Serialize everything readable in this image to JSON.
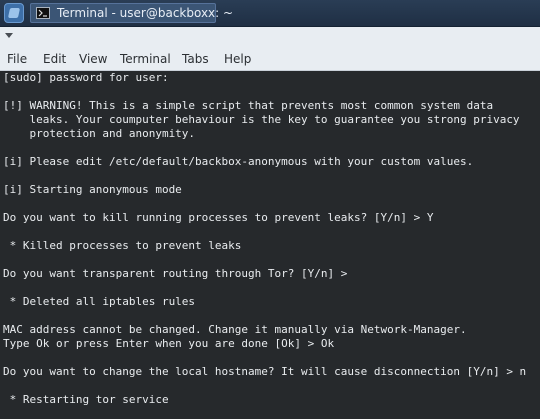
{
  "taskbar": {
    "launcher_icon": "backbox-logo-icon",
    "task": {
      "icon": "terminal-icon",
      "label": "Terminal - user@backboxx: ~"
    }
  },
  "toolbar": {
    "collapse_icon": "chevron-down-icon"
  },
  "menu": {
    "items": [
      "File",
      "Edit",
      "View",
      "Terminal",
      "Tabs",
      "Help"
    ]
  },
  "terminal": {
    "lines": [
      "[sudo] password for user:",
      "[!] WARNING! This is a simple script that prevents most common system data",
      "    leaks. Your coumputer behaviour is the key to guarantee you strong privacy",
      "    protection and anonymity.",
      "[i] Please edit /etc/default/backbox-anonymous with your custom values.",
      "[i] Starting anonymous mode",
      "Do you want to kill running processes to prevent leaks? [Y/n] > Y",
      " * Killed processes to prevent leaks",
      "Do you want transparent routing through Tor? [Y/n] >",
      " * Deleted all iptables rules",
      "MAC address cannot be changed. Change it manually via Network-Manager.",
      "Type Ok or press Enter when you are done [Ok] > Ok",
      "Do you want to change the local hostname? It will cause disconnection [Y/n] > n",
      " * Restarting tor service"
    ]
  },
  "colors": {
    "terminal_bg": "#26292c",
    "terminal_fg": "#e9ecef",
    "titlebar_bg": "#1f2f44",
    "menubar_bg": "#e8edf2"
  }
}
